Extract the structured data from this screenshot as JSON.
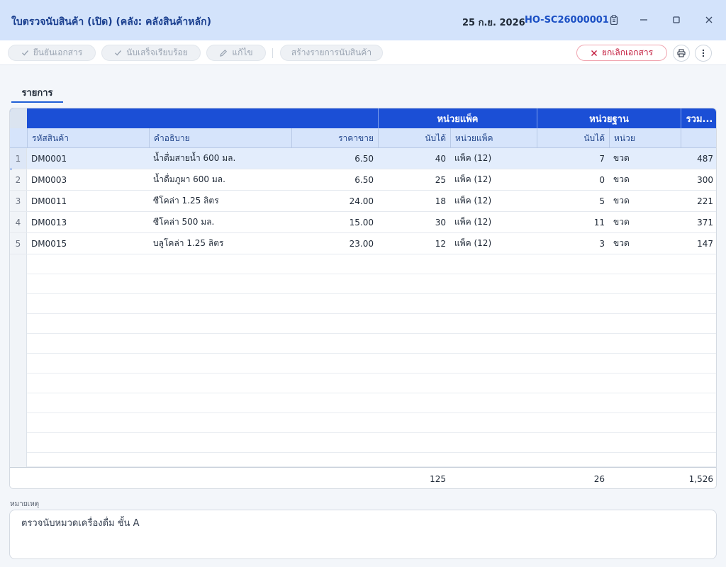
{
  "window": {
    "title": "ใบตรวจนับสินค้า (เปิด) (คลัง: คลังสินค้าหลัก)",
    "date": "25 ก.ย. 2026",
    "doc_no": "HO-SC26000001"
  },
  "toolbar": {
    "confirm_label": "ยืนยันเอกสาร",
    "finish_count_label": "นับเสร็จเรียบร้อย",
    "edit_label": "แก้ไข",
    "create_list_label": "สร้างรายการนับสินค้า",
    "cancel_doc_label": "ยกเลิกเอกสาร"
  },
  "tabs": [
    {
      "label": "รายการ"
    }
  ],
  "grid": {
    "group_headers": {
      "pack": "หน่วยแพ็ค",
      "base": "หน่วยฐาน",
      "total": "รวม..."
    },
    "columns": {
      "code": "รหัสสินค้า",
      "desc": "คำอธิบาย",
      "price": "ราคาขาย",
      "pack_count": "นับได้",
      "pack_unit": "หน่วยแพ็ค",
      "base_count": "นับได้",
      "base_unit": "หน่วย"
    },
    "rows": [
      {
        "no": "1",
        "code": "DM0001",
        "desc": "น้ำดื่มสายน้ำ 600 มล.",
        "price": "6.50",
        "pack_count": "40",
        "pack_unit": "แพ็ค (12)",
        "base_count": "7",
        "base_unit": "ขวด",
        "total": "487"
      },
      {
        "no": "2",
        "code": "DM0003",
        "desc": "น้ำดื่มภูผา 600 มล.",
        "price": "6.50",
        "pack_count": "25",
        "pack_unit": "แพ็ค (12)",
        "base_count": "0",
        "base_unit": "ขวด",
        "total": "300"
      },
      {
        "no": "3",
        "code": "DM0011",
        "desc": "ซีโคล่า 1.25 ลิตร",
        "price": "24.00",
        "pack_count": "18",
        "pack_unit": "แพ็ค (12)",
        "base_count": "5",
        "base_unit": "ขวด",
        "total": "221"
      },
      {
        "no": "4",
        "code": "DM0013",
        "desc": "ซีโคล่า 500 มล.",
        "price": "15.00",
        "pack_count": "30",
        "pack_unit": "แพ็ค (12)",
        "base_count": "11",
        "base_unit": "ขวด",
        "total": "371"
      },
      {
        "no": "5",
        "code": "DM0015",
        "desc": "บลูโคล่า 1.25 ลิตร",
        "price": "23.00",
        "pack_count": "12",
        "pack_unit": "แพ็ค (12)",
        "base_count": "3",
        "base_unit": "ขวด",
        "total": "147"
      }
    ],
    "totals": {
      "pack_count": "125",
      "base_count": "26",
      "total": "1,526"
    }
  },
  "notes": {
    "label": "หมายเหตุ",
    "value": "ตรวจนับหมวดเครื่องดื่ม ชั้น A"
  },
  "icons": {
    "copy": "clipboard-icon",
    "minimize": "minimize-icon",
    "maximize": "maximize-icon",
    "close": "close-icon",
    "print": "printer-icon",
    "more": "more-vertical-icon"
  },
  "colors": {
    "accent": "#1b4fd6",
    "header_bg": "#d3e3fb",
    "danger": "#c2183a"
  }
}
